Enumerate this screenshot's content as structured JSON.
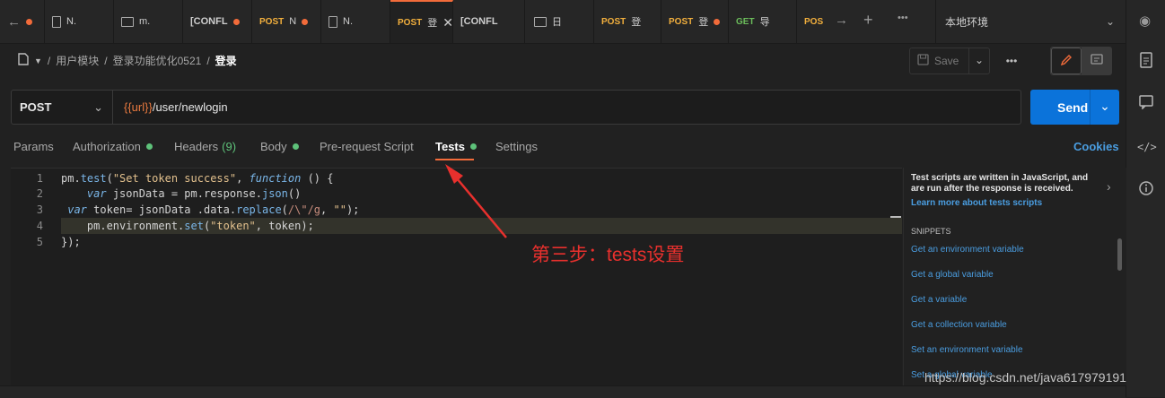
{
  "tabs": [
    {
      "method": "",
      "label": "",
      "icon": "back-arrow-icon"
    },
    {
      "method": "",
      "label": "N.",
      "icon": "document-icon"
    },
    {
      "method": "",
      "label": "m.",
      "icon": "folder-icon"
    },
    {
      "method": "",
      "label": "[CONFL",
      "icon": ""
    },
    {
      "method": "POST",
      "label": "N",
      "icon": ""
    },
    {
      "method": "",
      "label": "N.",
      "icon": "document-icon"
    },
    {
      "method": "POST",
      "label": "登",
      "icon": ""
    },
    {
      "method": "",
      "label": "[CONFL",
      "icon": ""
    },
    {
      "method": "",
      "label": "日",
      "icon": "folder-icon"
    },
    {
      "method": "POST",
      "label": "登",
      "icon": ""
    },
    {
      "method": "POST",
      "label": "登",
      "icon": ""
    },
    {
      "method": "GET",
      "label": "导",
      "icon": ""
    },
    {
      "method": "POS",
      "label": "",
      "icon": ""
    }
  ],
  "environment": {
    "selected": "本地环境"
  },
  "breadcrumb": {
    "items": [
      "用户模块",
      "登录功能优化0521"
    ],
    "current": "登录",
    "separator": "/"
  },
  "toolbar": {
    "save_label": "Save",
    "more_label": "•••"
  },
  "request": {
    "method": "POST",
    "url_var": "{{url}}",
    "url_path": "/user/newlogin",
    "send_label": "Send"
  },
  "request_tabs": {
    "params": "Params",
    "authorization": "Authorization",
    "headers": "Headers",
    "headers_count": "(9)",
    "body": "Body",
    "prerequest": "Pre-request Script",
    "tests": "Tests",
    "settings": "Settings",
    "cookies": "Cookies"
  },
  "editor": {
    "line_numbers": [
      "1",
      "2",
      "3",
      "4",
      "5"
    ],
    "lines": [
      {
        "t1": "pm.",
        "t2": "test",
        "t3": "(",
        "t4": "\"Set token success\"",
        "t5": ", ",
        "t6": "function",
        "t7": " () {"
      },
      {
        "t1": "    ",
        "t2": "var",
        "t3": " jsonData = pm.response.",
        "t4": "json",
        "t5": "()"
      },
      {
        "t1": " ",
        "t2": "var",
        "t3": " token= jsonData .data.",
        "t4": "replace",
        "t5": "(",
        "t6": "/\\\"/g",
        "t7": ", ",
        "t8": "\"\"",
        "t9": ");"
      },
      {
        "t1": "    pm.environment.",
        "t2": "set",
        "t3": "(",
        "t4": "\"token\"",
        "t5": ", token);"
      },
      {
        "t1": "});"
      }
    ]
  },
  "help": {
    "desc": "Test scripts are written in JavaScript, and are run after the response is received.",
    "learn_link": "Learn more about tests scripts",
    "snippets_title": "SNIPPETS",
    "snippets": [
      "Get an environment variable",
      "Get a global variable",
      "Get a variable",
      "Get a collection variable",
      "Set an environment variable",
      "Set a global variable"
    ]
  },
  "annotation": {
    "text": "第三步：tests设置"
  },
  "watermark": {
    "text": "https://blog.csdn.net/java617979191"
  },
  "colors": {
    "accent": "#f26b3a",
    "send": "#0b73da",
    "annotation": "#e8302d",
    "link": "#4a9de0",
    "status_dot": "#5ec27a"
  }
}
